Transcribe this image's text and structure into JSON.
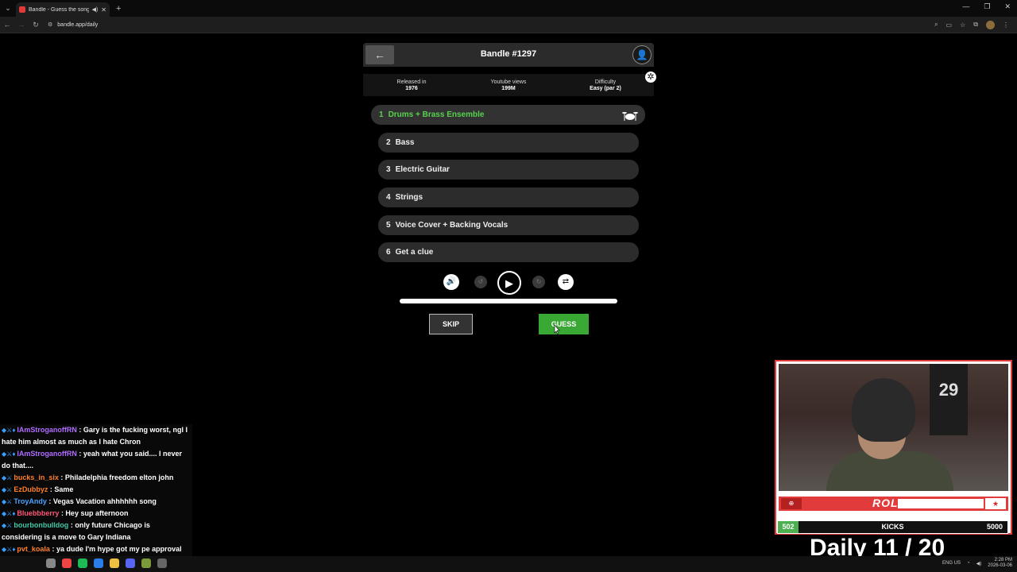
{
  "browser": {
    "tab_title": "Bandle - Guess the song, o",
    "tab_audio": "◀)",
    "tab_close": "✕",
    "new_tab": "+",
    "url": "bandle.app/daily",
    "window_minimize": "—",
    "window_restore": "❐",
    "window_close": "✕"
  },
  "game": {
    "title": "Bandle #1297",
    "back_icon": "←",
    "user_icon": "👤",
    "settings_icon": "✲",
    "stats": [
      {
        "label": "Released in",
        "value": "1976"
      },
      {
        "label": "Youtube views",
        "value": "199M"
      },
      {
        "label": "Difficulty",
        "value": "Easy (par 2)"
      }
    ],
    "rounds": [
      {
        "num": "1",
        "label": "Drums + Brass Ensemble",
        "active": true
      },
      {
        "num": "2",
        "label": "Bass"
      },
      {
        "num": "3",
        "label": "Electric Guitar"
      },
      {
        "num": "4",
        "label": "Strings"
      },
      {
        "num": "5",
        "label": "Voice Cover + Backing Vocals"
      },
      {
        "num": "6",
        "label": "Get a clue"
      }
    ],
    "controls": {
      "volume": "🔊",
      "rewind": "↺",
      "play": "▶",
      "forward": "↻",
      "repeat": "⇄"
    },
    "progress": 1.0,
    "skip_label": "SKIP",
    "guess_label": "GUESS",
    "accent_color": "#58d24e",
    "guess_color": "#3aa835"
  },
  "chat": [
    {
      "user": "IAmStroganoffRN",
      "color": "#b06cff",
      "text": ": Gary is the fucking worst, ngl I hate him almost as much as I hate Chron"
    },
    {
      "user": "IAmStroganoffRN",
      "color": "#b06cff",
      "text": ": yeah what you said.... I never do that...."
    },
    {
      "user": "bucks_in_six",
      "color": "#ff7f2a",
      "text": ": Philadelphia freedom elton john"
    },
    {
      "user": "EzDubbyz",
      "color": "#ff7f2a",
      "text": ": Same"
    },
    {
      "user": "TroyAndy",
      "color": "#4aa3ff",
      "text": ": Vegas Vacation ahhhhhh song"
    },
    {
      "user": "Bluebbberry",
      "color": "#ff5577",
      "text": ": Hey sup afternoon"
    },
    {
      "user": "bourbonbulldog",
      "color": "#3fc7a7",
      "text": ": only future Chicago is considering is a move to Gary Indiana"
    },
    {
      "user": "pvt_koala",
      "color": "#ff7f2a",
      "text": ": ya dude I'm hype got my pe approval letter today"
    }
  ],
  "stream": {
    "logo": "ROLO",
    "kicks_label": "KICKS",
    "kicks_current": "502",
    "kicks_max": "5000",
    "daily": "Daily  11 / 20",
    "jersey_number": "29"
  },
  "taskbar": {
    "lang": "ENG US",
    "time": "2:28 PM",
    "date": "2026-03-06"
  }
}
